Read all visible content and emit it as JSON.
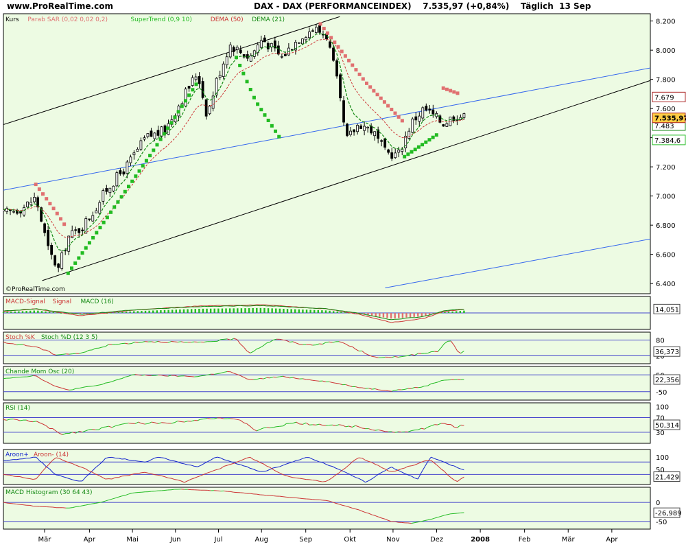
{
  "header": {
    "site": "www.ProRealTime.com",
    "title": "DAX - DAX (PERFORMANCEINDEX)    7.535,97 (+0,84%)    Täglich  13 Sep"
  },
  "colors": {
    "pane_bg": "#edfbe3",
    "sar": "#e07070",
    "supertrend": "#22bb22",
    "dema50": "#cc3333",
    "dema21": "#118811",
    "channel": "#000000",
    "blue_line": "#3366ee",
    "hline": "#4444cc",
    "badge_border": "#aa2222"
  },
  "chart_data": [
    {
      "type": "candlestick",
      "pane": "Kurs",
      "legend": [
        "Kurs",
        "Parab SAR (0,02 0,02 0,2)",
        "SuperTrend (0,9 10)",
        "DEMA (50)",
        "DEMA (21)"
      ],
      "x_ticks": [
        "Mär",
        "Apr",
        "Mai",
        "Jun",
        "Jul",
        "Aug",
        "Sep",
        "Okt",
        "Nov",
        "Dez",
        "2008",
        "Feb",
        "Mär",
        "Apr"
      ],
      "y_ticks": [
        "8.200",
        "8.000",
        "7.800",
        "7.600",
        "7.400",
        "7.200",
        "7.000",
        "6.800",
        "6.600",
        "6.400"
      ],
      "ylim": [
        6330,
        8250
      ],
      "close_path": [
        [
          0,
          6880
        ],
        [
          0.03,
          6920
        ],
        [
          0.05,
          6990
        ],
        [
          0.07,
          6620
        ],
        [
          0.085,
          6500
        ],
        [
          0.1,
          6720
        ],
        [
          0.12,
          6780
        ],
        [
          0.14,
          6900
        ],
        [
          0.16,
          7050
        ],
        [
          0.19,
          7200
        ],
        [
          0.22,
          7400
        ],
        [
          0.25,
          7450
        ],
        [
          0.27,
          7620
        ],
        [
          0.3,
          7850
        ],
        [
          0.315,
          7550
        ],
        [
          0.33,
          7800
        ],
        [
          0.35,
          8040
        ],
        [
          0.38,
          7950
        ],
        [
          0.4,
          8080
        ],
        [
          0.43,
          7950
        ],
        [
          0.46,
          8100
        ],
        [
          0.48,
          8150
        ],
        [
          0.5,
          8100
        ],
        [
          0.515,
          7800
        ],
        [
          0.53,
          7380
        ],
        [
          0.55,
          7500
        ],
        [
          0.57,
          7450
        ],
        [
          0.59,
          7300
        ],
        [
          0.61,
          7280
        ],
        [
          0.63,
          7500
        ],
        [
          0.65,
          7600
        ],
        [
          0.68,
          7500
        ],
        [
          0.7,
          7560
        ],
        [
          0.712,
          7540
        ]
      ],
      "sar_segments": [
        [
          [
            0.05,
            7080
          ],
          [
            0.08,
            6900
          ],
          [
            0.095,
            6800
          ]
        ],
        [
          [
            0.1,
            6470
          ],
          [
            0.16,
            6850
          ],
          [
            0.23,
            7300
          ],
          [
            0.3,
            7780
          ]
        ],
        [
          [
            0.36,
            7950
          ],
          [
            0.39,
            7650
          ],
          [
            0.43,
            7380
          ]
        ],
        [
          [
            0.49,
            8180
          ],
          [
            0.56,
            7780
          ],
          [
            0.62,
            7500
          ]
        ],
        [
          [
            0.62,
            7270
          ],
          [
            0.67,
            7420
          ]
        ],
        [
          [
            0.68,
            7740
          ],
          [
            0.705,
            7700
          ]
        ]
      ],
      "last_values": {
        "price": "7.535,97",
        "dema50": "7.679",
        "dema21": "7.483",
        "supertrend": "7.384,6"
      },
      "trendlines": [
        {
          "kind": "channel",
          "points": [
            [
              0.0,
              7490
            ],
            [
              0.52,
              8230
            ]
          ]
        },
        {
          "kind": "channel",
          "points": [
            [
              0.06,
              6420
            ],
            [
              1.3,
              8230
            ]
          ]
        },
        {
          "kind": "blue",
          "points": [
            [
              0.0,
              7040
            ],
            [
              1.36,
              8180
            ]
          ]
        },
        {
          "kind": "blue",
          "points": [
            [
              0.59,
              6370
            ],
            [
              1.36,
              7000
            ]
          ]
        }
      ]
    },
    {
      "type": "line+histogram",
      "pane": "MACD",
      "legend": [
        "MACD-Signal",
        "Signal",
        "MACD (16)"
      ],
      "y_ticks": [],
      "last_value": "14,051",
      "series": [
        [
          0,
          5
        ],
        [
          0.05,
          15
        ],
        [
          0.09,
          0
        ],
        [
          0.12,
          -10
        ],
        [
          0.2,
          10
        ],
        [
          0.3,
          25
        ],
        [
          0.4,
          30
        ],
        [
          0.5,
          15
        ],
        [
          0.55,
          -5
        ],
        [
          0.6,
          -35
        ],
        [
          0.65,
          -20
        ],
        [
          0.68,
          5
        ],
        [
          0.712,
          14
        ]
      ]
    },
    {
      "type": "line",
      "pane": "Stoch",
      "legend": [
        "Stoch %K",
        "Stoch %D (12 3 5)"
      ],
      "y_ticks": [
        "80",
        "20"
      ],
      "last_value": "36,373",
      "series": [
        [
          0,
          70
        ],
        [
          0.05,
          55
        ],
        [
          0.08,
          25
        ],
        [
          0.12,
          30
        ],
        [
          0.16,
          60
        ],
        [
          0.22,
          75
        ],
        [
          0.3,
          70
        ],
        [
          0.36,
          85
        ],
        [
          0.38,
          30
        ],
        [
          0.42,
          85
        ],
        [
          0.47,
          60
        ],
        [
          0.52,
          75
        ],
        [
          0.55,
          40
        ],
        [
          0.58,
          10
        ],
        [
          0.62,
          20
        ],
        [
          0.67,
          35
        ],
        [
          0.69,
          85
        ],
        [
          0.705,
          25
        ],
        [
          0.712,
          36
        ]
      ]
    },
    {
      "type": "line",
      "pane": "Chande",
      "legend": [
        "Chande Mom Osc (20)"
      ],
      "y_ticks": [
        "50",
        "-50"
      ],
      "last_value": "22,356",
      "series": [
        [
          0,
          30
        ],
        [
          0.05,
          45
        ],
        [
          0.08,
          -20
        ],
        [
          0.1,
          -40
        ],
        [
          0.15,
          -10
        ],
        [
          0.2,
          50
        ],
        [
          0.3,
          40
        ],
        [
          0.35,
          70
        ],
        [
          0.38,
          20
        ],
        [
          0.43,
          40
        ],
        [
          0.5,
          10
        ],
        [
          0.55,
          -25
        ],
        [
          0.6,
          -45
        ],
        [
          0.65,
          -20
        ],
        [
          0.68,
          20
        ],
        [
          0.712,
          22
        ]
      ]
    },
    {
      "type": "line",
      "pane": "RSI",
      "legend": [
        "RSI (14)"
      ],
      "y_ticks": [
        "100",
        "70",
        "30"
      ],
      "last_value": "50,314",
      "series": [
        [
          0,
          65
        ],
        [
          0.05,
          60
        ],
        [
          0.09,
          25
        ],
        [
          0.13,
          35
        ],
        [
          0.2,
          55
        ],
        [
          0.25,
          55
        ],
        [
          0.33,
          70
        ],
        [
          0.37,
          60
        ],
        [
          0.39,
          35
        ],
        [
          0.45,
          55
        ],
        [
          0.5,
          50
        ],
        [
          0.55,
          45
        ],
        [
          0.6,
          30
        ],
        [
          0.64,
          35
        ],
        [
          0.68,
          55
        ],
        [
          0.7,
          45
        ],
        [
          0.712,
          50
        ]
      ]
    },
    {
      "type": "line",
      "pane": "Aroon",
      "legend": [
        "Aroon+",
        "Aroon- (14)"
      ],
      "y_ticks": [
        "100",
        "50"
      ],
      "last_value": "21,429",
      "series_up": [
        [
          0,
          85
        ],
        [
          0.05,
          100
        ],
        [
          0.08,
          30
        ],
        [
          0.12,
          0
        ],
        [
          0.16,
          100
        ],
        [
          0.22,
          80
        ],
        [
          0.24,
          100
        ],
        [
          0.3,
          60
        ],
        [
          0.33,
          100
        ],
        [
          0.4,
          40
        ],
        [
          0.47,
          100
        ],
        [
          0.52,
          50
        ],
        [
          0.56,
          0
        ],
        [
          0.6,
          60
        ],
        [
          0.64,
          10
        ],
        [
          0.66,
          100
        ],
        [
          0.71,
          50
        ]
      ],
      "series_down": [
        [
          0,
          30
        ],
        [
          0.05,
          10
        ],
        [
          0.08,
          100
        ],
        [
          0.12,
          60
        ],
        [
          0.16,
          10
        ],
        [
          0.22,
          40
        ],
        [
          0.28,
          0
        ],
        [
          0.33,
          50
        ],
        [
          0.38,
          100
        ],
        [
          0.44,
          20
        ],
        [
          0.5,
          0
        ],
        [
          0.55,
          100
        ],
        [
          0.6,
          40
        ],
        [
          0.66,
          90
        ],
        [
          0.7,
          0
        ],
        [
          0.712,
          21
        ]
      ]
    },
    {
      "type": "line",
      "pane": "MACD Histogram",
      "legend": [
        "MACD Histogram (30 64 43)"
      ],
      "y_ticks": [
        "0",
        "-50"
      ],
      "last_value": "-26,989",
      "series": [
        [
          0,
          0
        ],
        [
          0.05,
          -10
        ],
        [
          0.1,
          -15
        ],
        [
          0.15,
          0
        ],
        [
          0.2,
          25
        ],
        [
          0.27,
          35
        ],
        [
          0.34,
          30
        ],
        [
          0.4,
          20
        ],
        [
          0.5,
          5
        ],
        [
          0.55,
          -20
        ],
        [
          0.6,
          -50
        ],
        [
          0.63,
          -55
        ],
        [
          0.66,
          -45
        ],
        [
          0.69,
          -30
        ],
        [
          0.712,
          -27
        ]
      ]
    }
  ]
}
